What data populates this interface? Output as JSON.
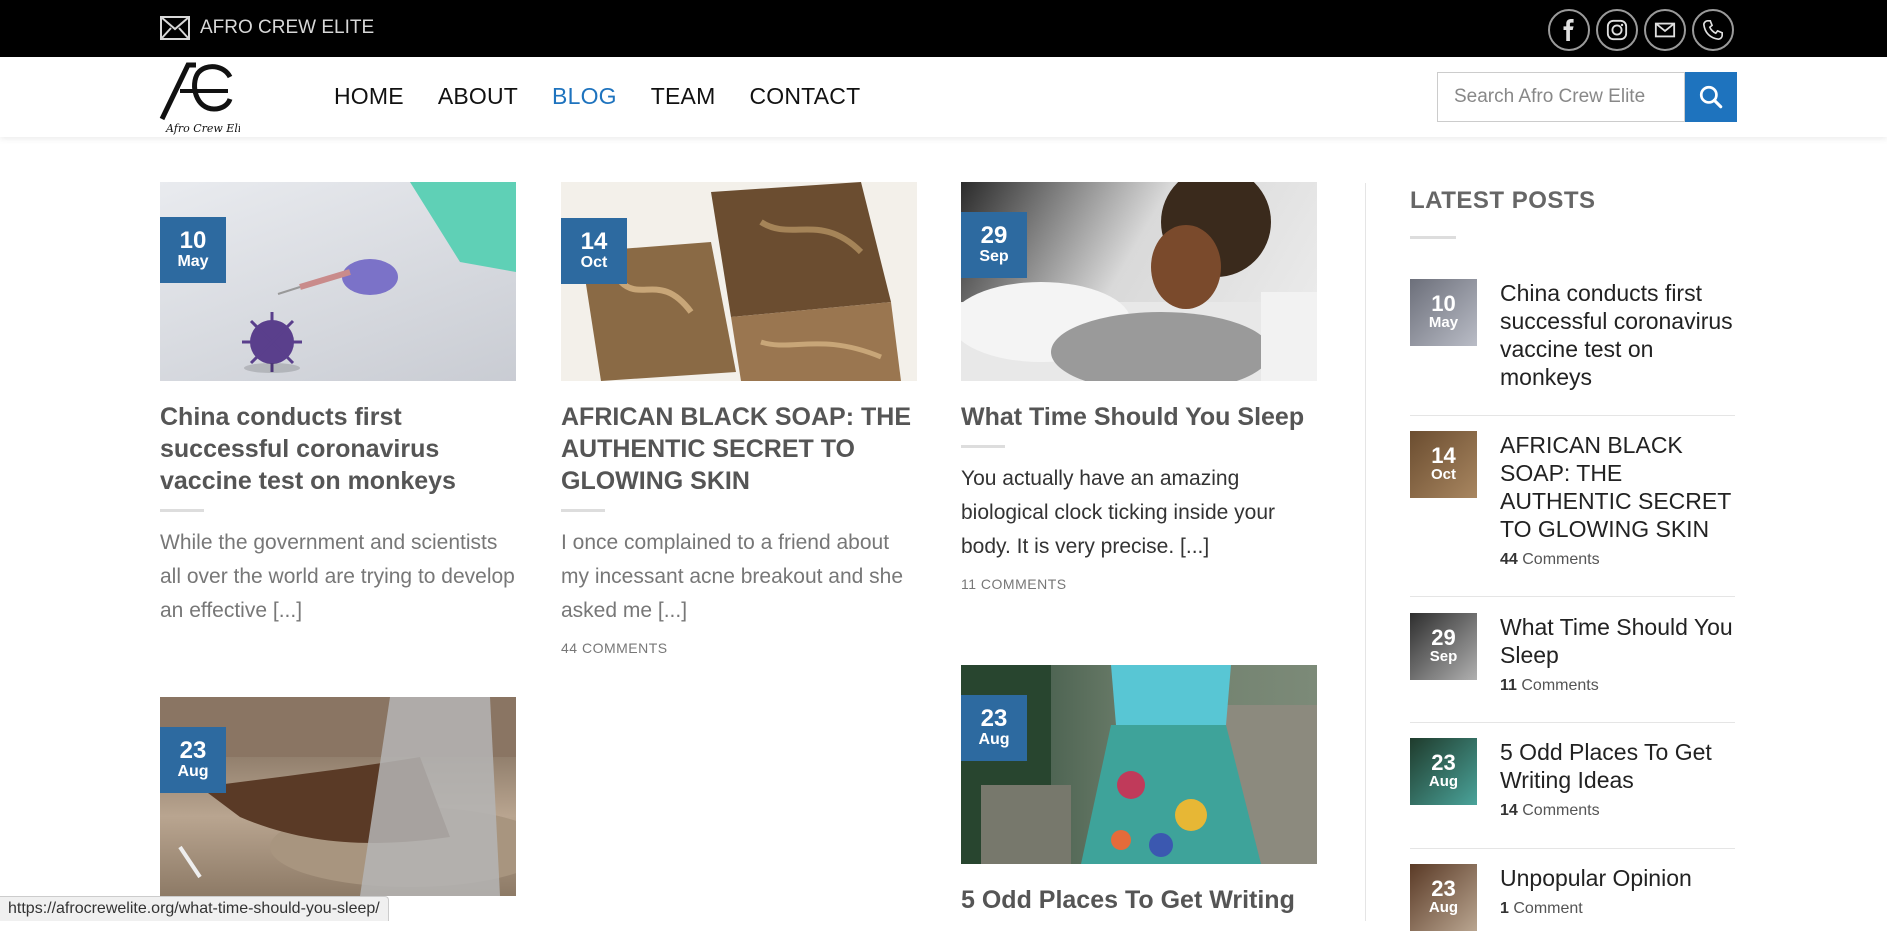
{
  "topbar": {
    "site_name": "AFRO CREW ELITE",
    "social": [
      "facebook-icon",
      "instagram-icon",
      "envelope-icon",
      "phone-icon"
    ]
  },
  "header": {
    "logo_text": "Afro Crew Elite",
    "nav": [
      {
        "label": "HOME",
        "active": false
      },
      {
        "label": "ABOUT",
        "active": false
      },
      {
        "label": "BLOG",
        "active": true
      },
      {
        "label": "TEAM",
        "active": false
      },
      {
        "label": "CONTACT",
        "active": false
      }
    ],
    "search_placeholder": "Search Afro Crew Elite"
  },
  "colors": {
    "accent": "#1e73be",
    "badge": "#2d6aa0",
    "topbar": "#000000"
  },
  "posts": [
    {
      "day": "10",
      "month": "May",
      "title": "China conducts first successful coronavirus vaccine test on monkeys",
      "excerpt": "While the government and scientists all over the world are trying to develop an effective [...]",
      "comments": ""
    },
    {
      "day": "14",
      "month": "Oct",
      "title": "AFRICAN BLACK SOAP: THE AUTHENTIC SECRET TO GLOWING SKIN",
      "excerpt": "I once complained to a friend about my incessant acne breakout and she asked me [...]",
      "comments": "44 COMMENTS"
    },
    {
      "day": "29",
      "month": "Sep",
      "title": "What Time Should You Sleep",
      "excerpt": "You actually have an amazing biological clock ticking inside your body. It is very precise. [...]",
      "comments": "11 COMMENTS"
    },
    {
      "day": "23",
      "month": "Aug",
      "title": "",
      "excerpt": "",
      "comments": ""
    },
    {
      "day": "23",
      "month": "Aug",
      "title": "5 Odd Places To Get Writing",
      "excerpt": "",
      "comments": ""
    }
  ],
  "sidebar": {
    "title": "LATEST POSTS",
    "items": [
      {
        "day": "10",
        "month": "May",
        "title": "China conducts first successful coronavirus vaccine test on monkeys",
        "count": "",
        "label": ""
      },
      {
        "day": "14",
        "month": "Oct",
        "title": "AFRICAN BLACK SOAP: THE AUTHENTIC SECRET TO GLOWING SKIN",
        "count": "44",
        "label": "Comments"
      },
      {
        "day": "29",
        "month": "Sep",
        "title": "What Time Should You Sleep",
        "count": "11",
        "label": "Comments"
      },
      {
        "day": "23",
        "month": "Aug",
        "title": "5 Odd Places To Get Writing Ideas",
        "count": "14",
        "label": "Comments"
      },
      {
        "day": "23",
        "month": "Aug",
        "title": "Unpopular Opinion",
        "count": "1",
        "label": "Comment"
      }
    ]
  },
  "status_url": "https://afrocrewelite.org/what-time-should-you-sleep/"
}
